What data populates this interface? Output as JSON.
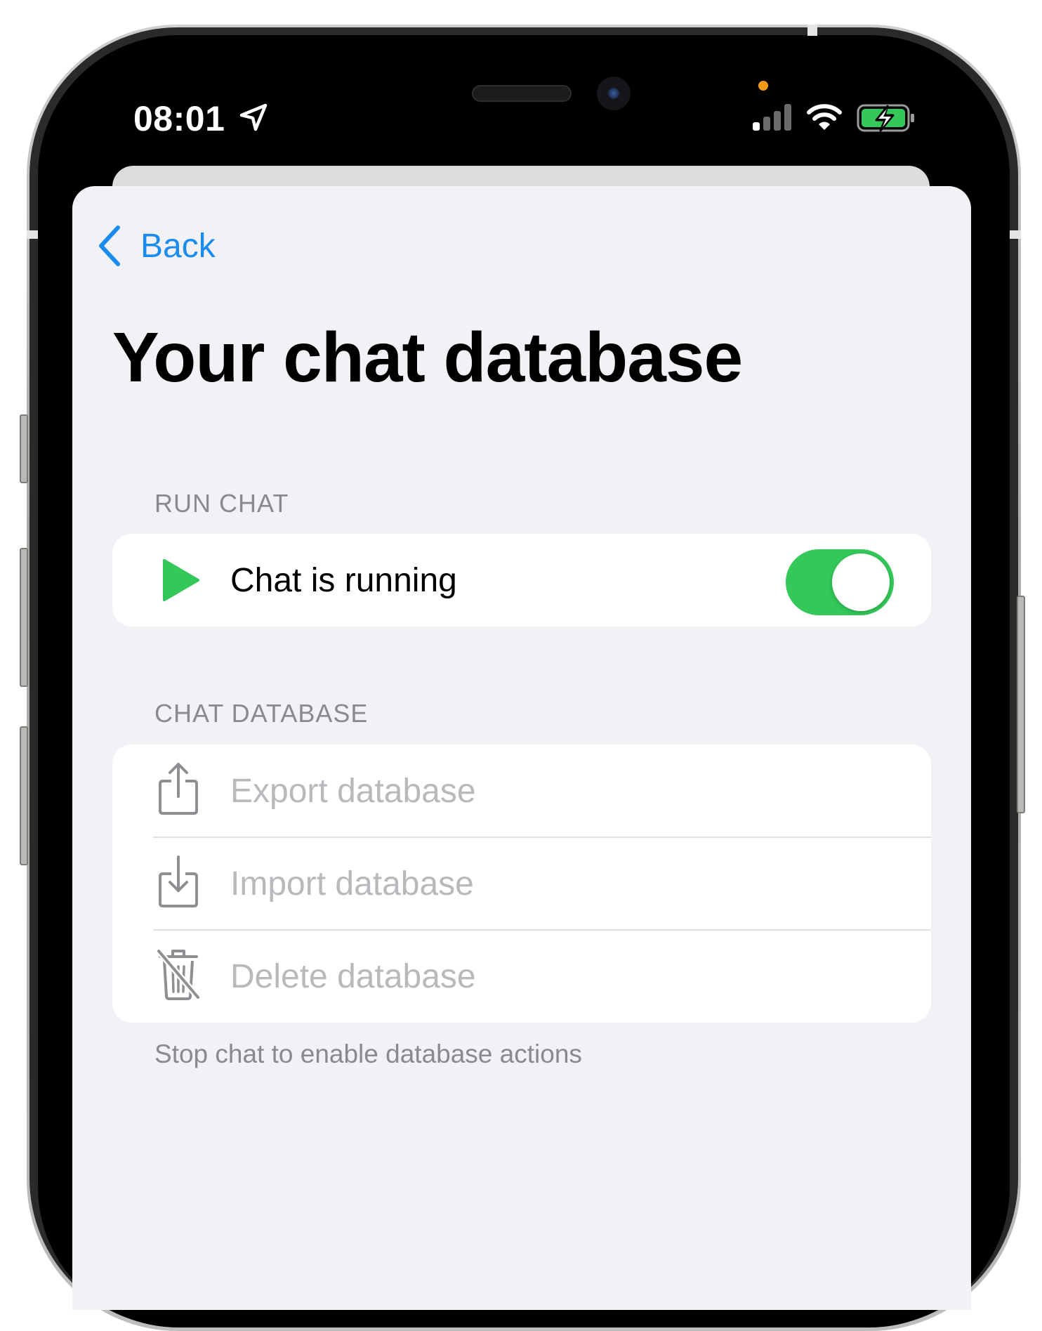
{
  "status_bar": {
    "time": "08:01",
    "icons": [
      "location-arrow-icon",
      "cellular-signal-icon",
      "wifi-icon",
      "battery-charging-icon"
    ]
  },
  "nav": {
    "back_label": "Back"
  },
  "page": {
    "title": "Your chat database"
  },
  "run_chat": {
    "header": "RUN CHAT",
    "row_label": "Chat is running",
    "toggle_on": true
  },
  "chat_database": {
    "header": "CHAT DATABASE",
    "items": [
      {
        "label": "Export database",
        "icon": "share-export-icon",
        "enabled": false
      },
      {
        "label": "Import database",
        "icon": "import-tray-icon",
        "enabled": false
      },
      {
        "label": "Delete database",
        "icon": "trash-slash-icon",
        "enabled": false
      }
    ],
    "footer": "Stop chat to enable database actions"
  },
  "colors": {
    "accent": "#1a8cf0",
    "toggle_on": "#34c759",
    "play_icon": "#34c759",
    "background": "#f1f1f6",
    "disabled_text": "#b9b9bd",
    "secondary_text": "#8a8a8e",
    "battery_fill": "#34c759"
  }
}
